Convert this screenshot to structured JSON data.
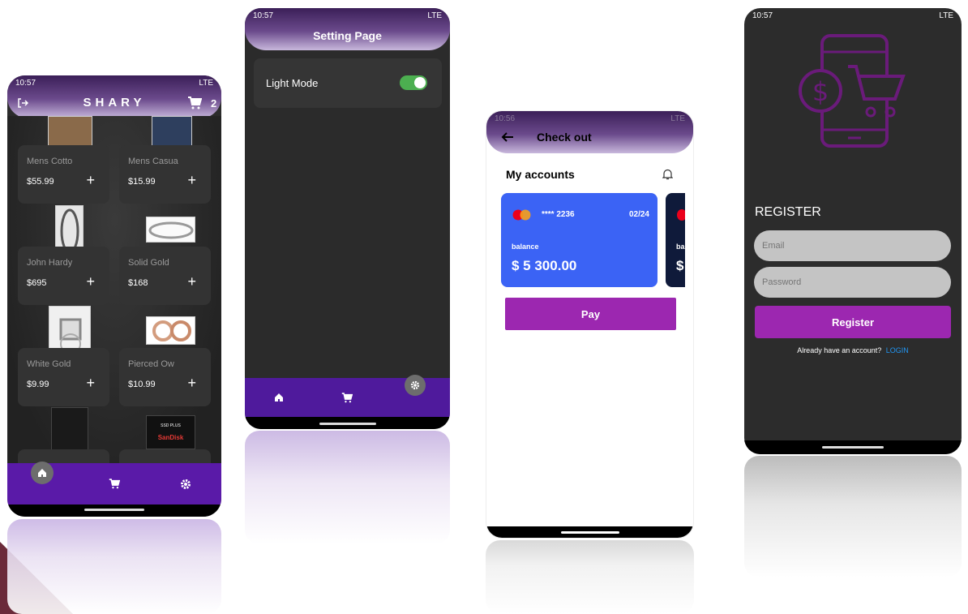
{
  "shop": {
    "status_time": "10:57",
    "status_net": "LTE",
    "title": "SHARY",
    "cart_count": "2",
    "products": [
      {
        "name": "Mens Cotto",
        "price": "$55.99"
      },
      {
        "name": "Mens Casua",
        "price": "$15.99"
      },
      {
        "name": "John Hardy",
        "price": "$695"
      },
      {
        "name": "Solid Gold",
        "price": "$168"
      },
      {
        "name": "White Gold",
        "price": "$9.99"
      },
      {
        "name": "Pierced Ow",
        "price": "$10.99"
      }
    ],
    "plus": "+",
    "thumb_label_ssd": "SSD PLUS",
    "thumb_label_brand": "SanDisk"
  },
  "settings": {
    "status_time": "10:57",
    "status_net": "LTE",
    "title": "Setting Page",
    "light_mode_label": "Light Mode",
    "light_mode_on": true,
    "toggle_color": "#4caf50"
  },
  "checkout": {
    "status_time": "10:56",
    "status_net": "LTE",
    "title": "Check out",
    "accounts_title": "My accounts",
    "card": {
      "number": "**** 2236",
      "expiry": "02/24",
      "balance_label": "balance",
      "balance": "$ 5 300.00",
      "color": "#3b63f5"
    },
    "second_card_label": "ba",
    "second_card_balance": "$",
    "pay_label": "Pay",
    "pay_color": "#9c27b0"
  },
  "register": {
    "status_time": "10:57",
    "status_net": "LTE",
    "heading": "REGISTER",
    "email_placeholder": "Email",
    "password_placeholder": "Password",
    "register_label": "Register",
    "have_account": "Already have an account?",
    "login_link": "LOGIN",
    "accent": "#9c27b0",
    "link_color": "#2196f3"
  },
  "icons": [
    "logout-icon",
    "cart-icon",
    "home-icon",
    "gear-icon",
    "back-arrow-icon",
    "bell-icon",
    "mastercard-icon",
    "shopping-phone-icon"
  ]
}
